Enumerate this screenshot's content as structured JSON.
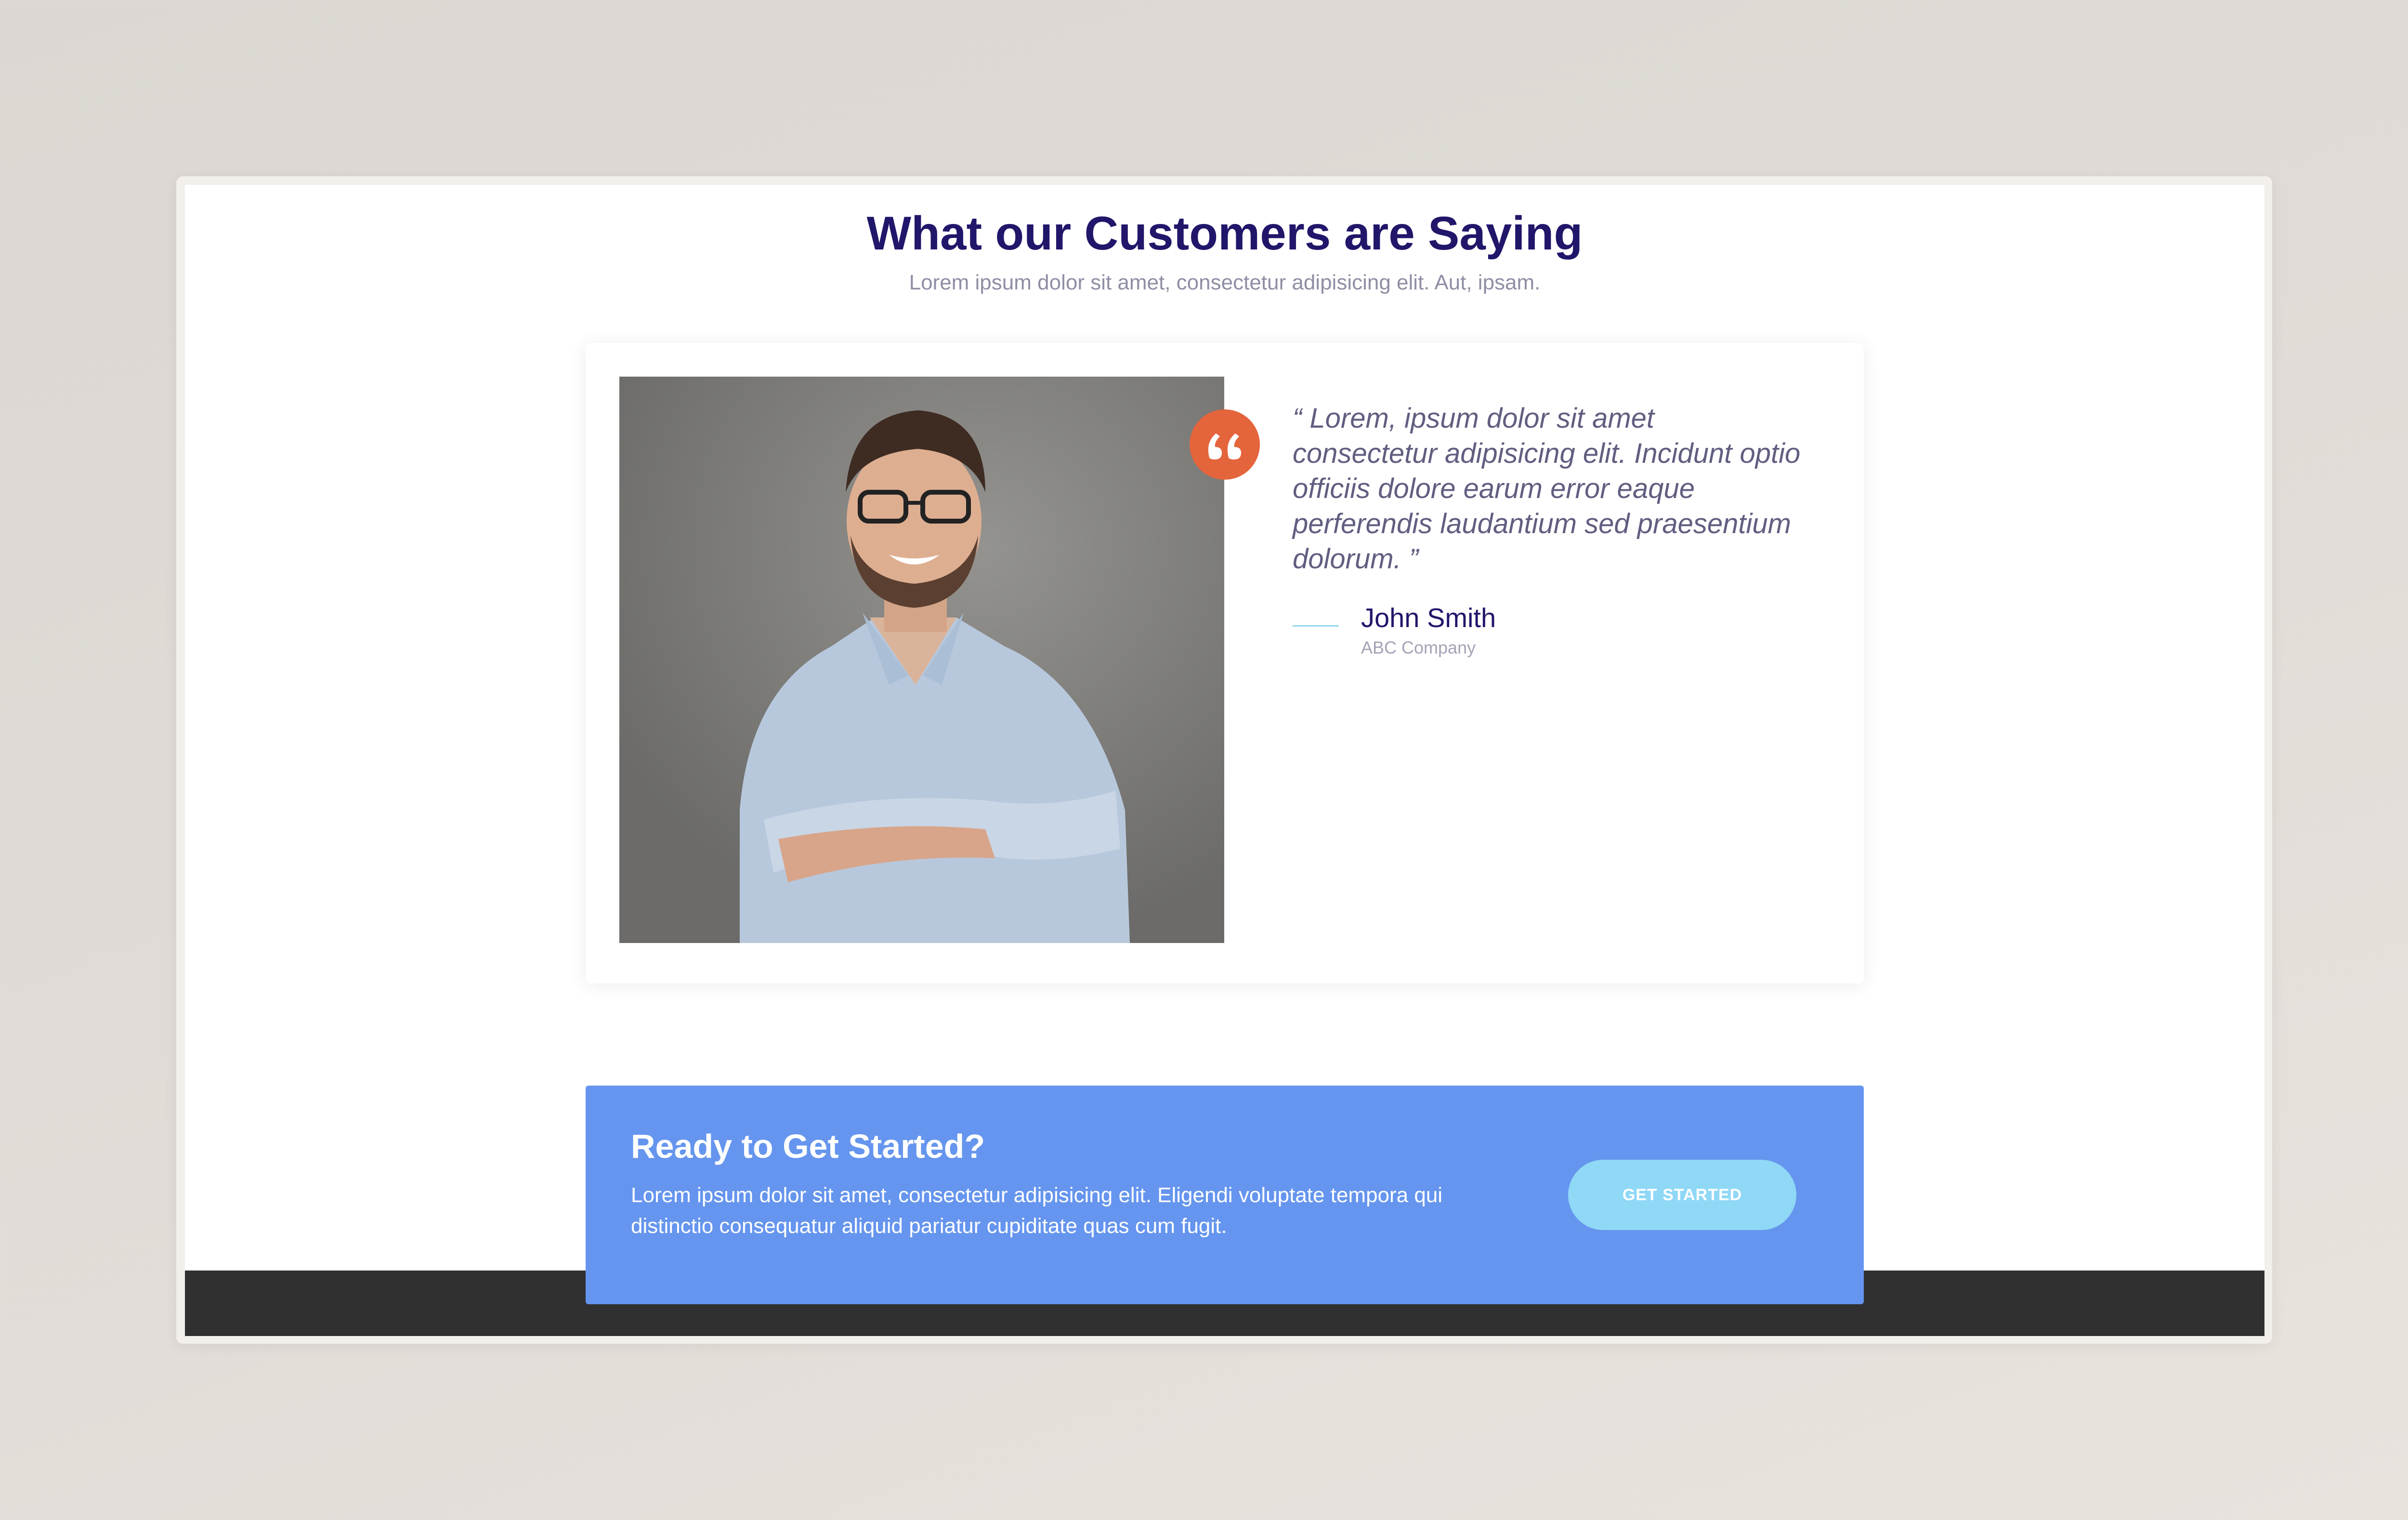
{
  "testimonials": {
    "title": "What our Customers are Saying",
    "subtitle": "Lorem ipsum dolor sit amet, consectetur adipisicing elit. Aut, ipsam.",
    "items": [
      {
        "quote": "“ Lorem, ipsum dolor sit amet consectetur adipisicing elit. Incidunt optio officiis dolore earum error eaque perferendis laudantium sed praesentium dolorum. ”",
        "author_name": "John Smith",
        "author_company": "ABC Company",
        "photo_icon": "person-photo",
        "quote_icon": "quote-icon"
      }
    ]
  },
  "cta": {
    "title": "Ready to Get Started?",
    "text": "Lorem ipsum dolor sit amet, consectetur adipisicing elit. Eligendi voluptate tempora qui distinctio consequatur aliquid pariatur cupiditate quas cum fugit.",
    "button_label": "GET STARTED"
  },
  "colors": {
    "heading": "#20166a",
    "accent_orange": "#e4643b",
    "cta_background": "#6595ee",
    "cta_button": "#8fd8f6",
    "footer": "#303030"
  }
}
